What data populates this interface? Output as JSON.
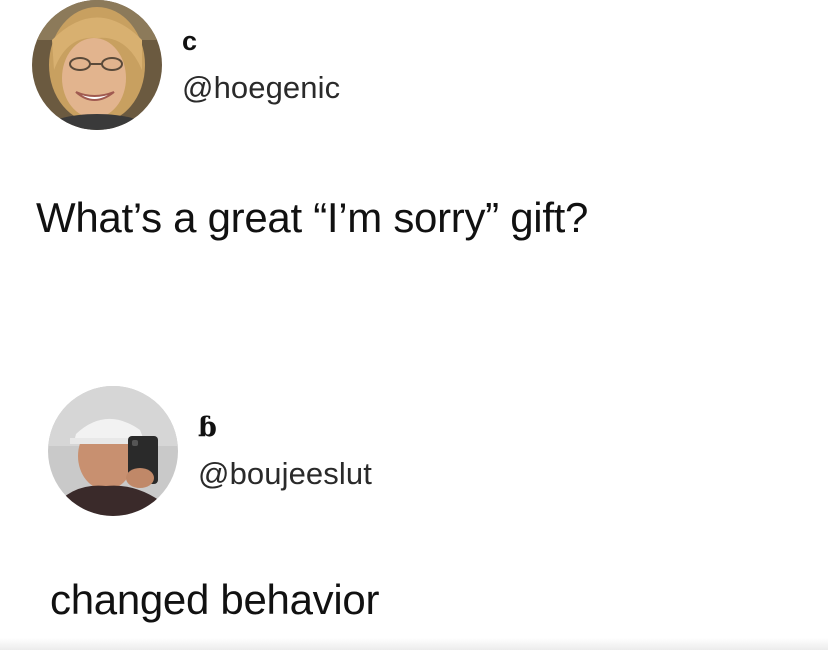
{
  "tweets": [
    {
      "display_name": "c",
      "handle": "@hoegenic",
      "text": "What’s a great “I’m sorry” gift?",
      "avatar_icon": "user-avatar-photo"
    },
    {
      "display_name": "ɓ",
      "handle": "@boujeeslut",
      "text": "changed behavior",
      "avatar_icon": "user-avatar-photo"
    }
  ]
}
